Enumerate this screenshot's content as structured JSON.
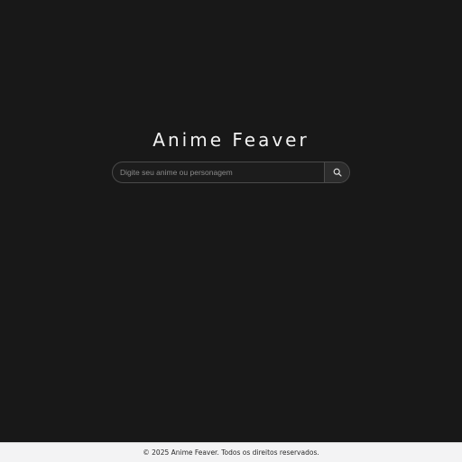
{
  "header": {
    "title": "Anime Feaver"
  },
  "search": {
    "placeholder": "Digite seu anime ou personagem",
    "value": "",
    "button_icon": "search-icon"
  },
  "footer": {
    "text": "© 2025 Anime Feaver. Todos os direitos reservados."
  },
  "colors": {
    "background": "#181818",
    "title": "#f2f2f2",
    "footer_background": "#f3f3f4"
  }
}
